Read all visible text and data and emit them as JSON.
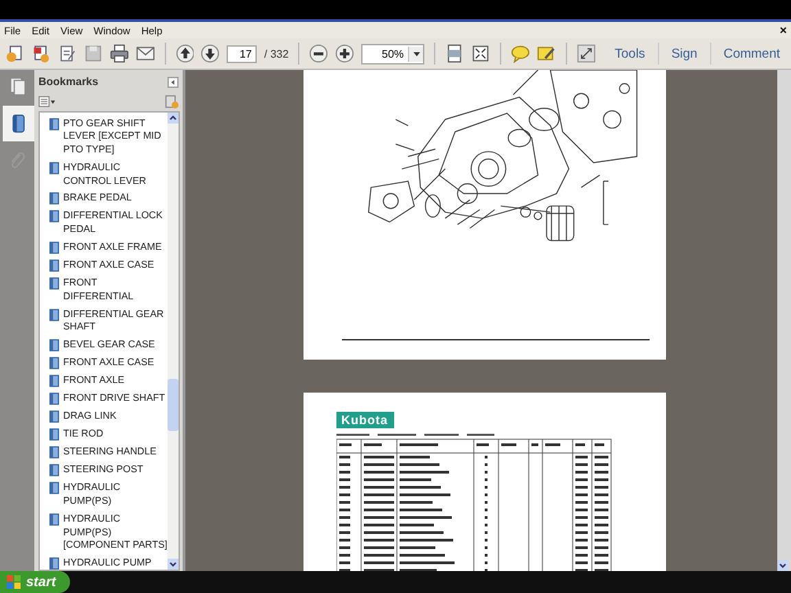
{
  "menu": [
    "File",
    "Edit",
    "View",
    "Window",
    "Help"
  ],
  "close": "×",
  "toolbar": {
    "page": "17",
    "page_count": "/ 332",
    "zoom": "50%",
    "links": [
      "Tools",
      "Sign",
      "Comment"
    ]
  },
  "sidebar": {
    "title": "Bookmarks",
    "bookmarks": [
      {
        "label": "PTO GEAR SHIFT LEVER [EXCEPT MID PTO TYPE]"
      },
      {
        "label": "HYDRAULIC CONTROL LEVER"
      },
      {
        "label": "BRAKE PEDAL"
      },
      {
        "label": "DIFFERENTIAL LOCK PEDAL"
      },
      {
        "label": "FRONT AXLE FRAME"
      },
      {
        "label": "FRONT AXLE CASE"
      },
      {
        "label": "FRONT DIFFERENTIAL"
      },
      {
        "label": "DIFFERENTIAL GEAR SHAFT"
      },
      {
        "label": "BEVEL GEAR CASE"
      },
      {
        "label": "FRONT AXLE CASE"
      },
      {
        "label": "FRONT AXLE"
      },
      {
        "label": "FRONT DRIVE SHAFT"
      },
      {
        "label": "DRAG LINK"
      },
      {
        "label": "TIE ROD"
      },
      {
        "label": "STEERING HANDLE"
      },
      {
        "label": "STEERING POST"
      },
      {
        "label": "HYDRAULIC PUMP(PS)"
      },
      {
        "label": "HYDRAULIC PUMP(PS) [COMPONENT PARTS]"
      },
      {
        "label": "HYDRAULIC PUMP"
      }
    ]
  },
  "document": {
    "logo": "Kubota"
  },
  "taskbar": {
    "start": "start"
  }
}
